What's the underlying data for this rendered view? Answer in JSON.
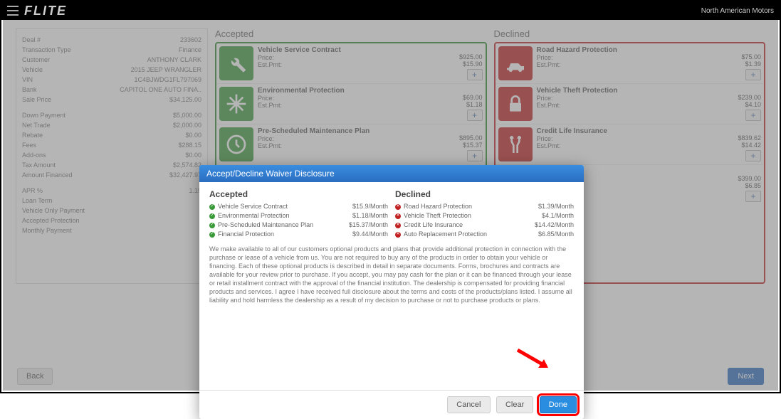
{
  "topbar": {
    "brand": "FLITE",
    "tenant": "North American Motors"
  },
  "deal": {
    "rows1": [
      {
        "l": "Deal #",
        "v": "233602"
      },
      {
        "l": "Transaction Type",
        "v": "Finance"
      },
      {
        "l": "Customer",
        "v": "ANTHONY CLARK"
      },
      {
        "l": "Vehicle",
        "v": "2015 JEEP WRANGLER"
      },
      {
        "l": "VIN",
        "v": "1C4BJWDG1FL797069"
      },
      {
        "l": "Bank",
        "v": "CAPITOL ONE AUTO FINA.."
      },
      {
        "l": "Sale Price",
        "v": "$34,125.00"
      }
    ],
    "rows2": [
      {
        "l": "Down Payment",
        "v": "$5,000.00"
      },
      {
        "l": "Net Trade",
        "v": "$2,000.00"
      },
      {
        "l": "Rebate",
        "v": "$0.00"
      },
      {
        "l": "Fees",
        "v": "$288.15"
      },
      {
        "l": "Add-ons",
        "v": "$0.00"
      },
      {
        "l": "Tax Amount",
        "v": "$2,574.82"
      },
      {
        "l": "Amount Financed",
        "v": "$32,427.97"
      }
    ],
    "rows3": [
      {
        "l": "APR %",
        "v": "1.19"
      },
      {
        "l": "Loan Term",
        "v": ""
      },
      {
        "l": "Vehicle Only Payment",
        "v": ""
      },
      {
        "l": "Accepted Protection",
        "v": ""
      },
      {
        "l": "Monthly Payment",
        "v": ""
      }
    ]
  },
  "columns": {
    "accepted_title": "Accepted",
    "declined_title": "Declined"
  },
  "accepted": [
    {
      "icon": "wrench",
      "title": "Vehicle Service Contract",
      "price": "$925.00",
      "est": "$15.90"
    },
    {
      "icon": "snow",
      "title": "Environmental Protection",
      "price": "$69.00",
      "est": "$1.18"
    },
    {
      "icon": "clock",
      "title": "Pre-Scheduled Maintenance Plan",
      "price": "$895.00",
      "est": "$15.37"
    }
  ],
  "declined": [
    {
      "icon": "tow",
      "title": "Road Hazard Protection",
      "price": "$75.00",
      "est": "$1.39"
    },
    {
      "icon": "lock",
      "title": "Vehicle Theft Protection",
      "price": "$239.00",
      "est": "$4.10"
    },
    {
      "icon": "crutch",
      "title": "Credit Life Insurance",
      "price": "$839.62",
      "est": "$14.42"
    },
    {
      "icon": "replace",
      "title": "",
      "price": "$399.00",
      "est": "$6.85"
    }
  ],
  "labels": {
    "price": "Price:",
    "est": "Est.Pmt:"
  },
  "modal": {
    "title": "Accept/Decline Waiver Disclosure",
    "accepted_h": "Accepted",
    "declined_h": "Declined",
    "accepted": [
      {
        "l": "Vehicle Service Contract",
        "p": "$15.9/Month"
      },
      {
        "l": "Environmental Protection",
        "p": "$1.18/Month"
      },
      {
        "l": "Pre-Scheduled Maintenance Plan",
        "p": "$15.37/Month"
      },
      {
        "l": "Financial Protection",
        "p": "$9.44/Month"
      }
    ],
    "declined": [
      {
        "l": "Road Hazard Protection",
        "p": "$1.39/Month"
      },
      {
        "l": "Vehicle Theft Protection",
        "p": "$4.1/Month"
      },
      {
        "l": "Credit Life Insurance",
        "p": "$14.42/Month"
      },
      {
        "l": "Auto Replacement Protection",
        "p": "$6.85/Month"
      }
    ],
    "disclosure": "We make available to all of our customers optional products and plans that provide additional protection in connection with the purchase or lease of a vehicle from us. You are not required to buy any of the products in order to obtain your vehicle or financing. Each of these optional products is described in detail in separate documents. Forms, brochures and contracts are available for your review prior to purchase. If you accept, you may pay cash for the plan or it can be financed through your lease or retail installment contract with the approval of the financial institution. The dealership is compensated for providing financial products and services. I agree I have received full disclosure about the terms and costs of the products/plans listed. I assume all liability and hold harmless the dealership as a result of my decision to purchase or not to purchase products or plans.",
    "cancel": "Cancel",
    "clear": "Clear",
    "done": "Done"
  },
  "footer": {
    "back": "Back",
    "next": "Next"
  }
}
